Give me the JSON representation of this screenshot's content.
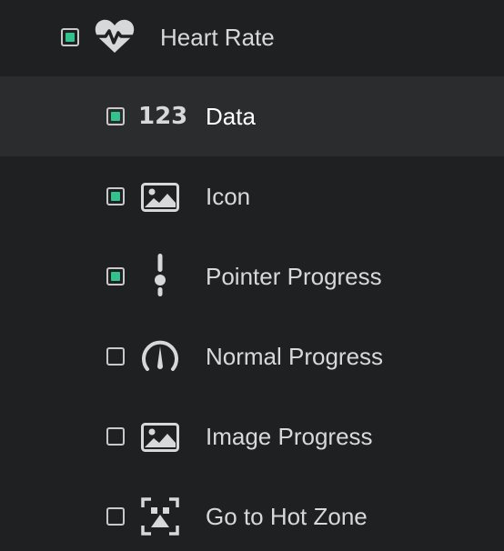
{
  "tree": {
    "parent": {
      "label": "Heart Rate",
      "checked": true,
      "icon": "heart-rate-icon"
    },
    "children": [
      {
        "label": "Data",
        "checked": true,
        "icon": "number-123-icon",
        "icon_text": "123",
        "selected": true
      },
      {
        "label": "Icon",
        "checked": true,
        "icon": "image-icon"
      },
      {
        "label": "Pointer Progress",
        "checked": true,
        "icon": "pointer-progress-icon"
      },
      {
        "label": "Normal Progress",
        "checked": false,
        "icon": "gauge-icon"
      },
      {
        "label": "Image Progress",
        "checked": false,
        "icon": "image-icon"
      },
      {
        "label": "Go to Hot Zone",
        "checked": false,
        "icon": "hot-zone-icon"
      }
    ]
  },
  "colors": {
    "background": "#1f2022",
    "selected_row": "#2b2c2e",
    "check_fill": "#33c28e",
    "text": "#d7d8da"
  }
}
